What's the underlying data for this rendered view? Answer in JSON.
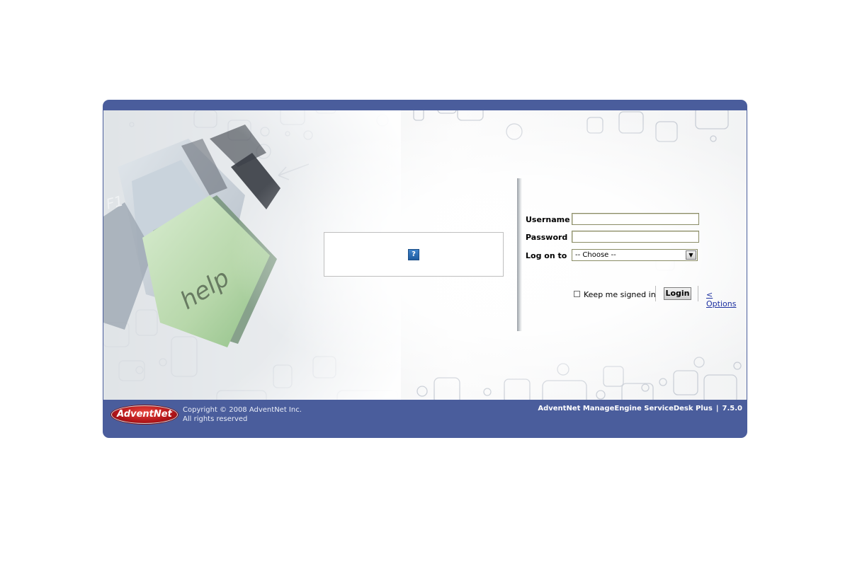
{
  "help": {
    "icon": "help-question-icon",
    "glyph": "?"
  },
  "form": {
    "username_label": "Username",
    "password_label": "Password",
    "logon_label": "Log on to",
    "logon_selected": "-- Choose --",
    "keep_signed_in": "Keep me signed in",
    "login_button": "Login",
    "options_link": "< Options"
  },
  "footer": {
    "logo_text": "AdventNet",
    "copyright_line1": "Copyright © 2008 AdventNet Inc.",
    "copyright_line2": "All rights reserved",
    "product": "AdventNet ManageEngine ServiceDesk Plus",
    "version": "7.5.0"
  },
  "colors": {
    "frame": "#4a5d9c",
    "link": "#1b2fa0",
    "logo_red": "#b3161a"
  }
}
